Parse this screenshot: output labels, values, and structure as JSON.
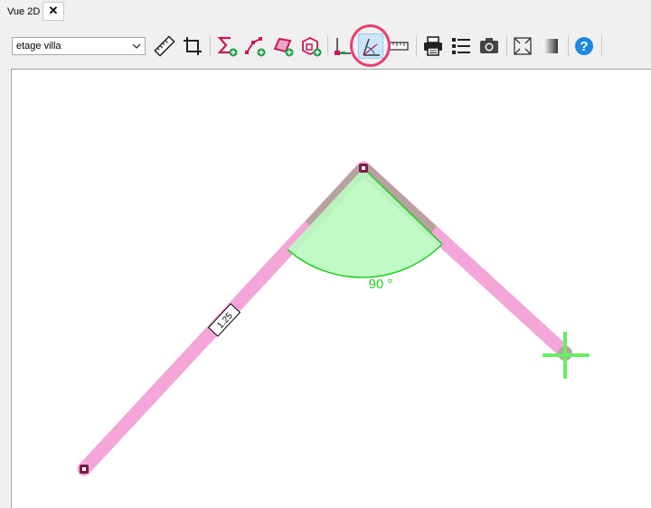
{
  "window": {
    "tab_title": "Vue 2D",
    "close_glyph": "✕"
  },
  "toolbar": {
    "floor_select": {
      "selected": "etage villa"
    },
    "buttons": [
      {
        "id": "measure",
        "icon": "ruler-icon"
      },
      {
        "id": "crop",
        "icon": "crop-icon"
      },
      {
        "id": "sum",
        "icon": "sum-add-icon"
      },
      {
        "id": "polyline",
        "icon": "polyline-add-icon"
      },
      {
        "id": "polygon",
        "icon": "polygon-add-icon"
      },
      {
        "id": "object",
        "icon": "object-add-icon"
      },
      {
        "id": "axis",
        "icon": "axis-icon"
      },
      {
        "id": "angle",
        "icon": "angle-icon",
        "active": true
      },
      {
        "id": "scale",
        "icon": "scale-ruler-icon"
      },
      {
        "id": "print",
        "icon": "printer-icon"
      },
      {
        "id": "list",
        "icon": "list-icon"
      },
      {
        "id": "snapshot",
        "icon": "camera-icon"
      },
      {
        "id": "fit",
        "icon": "fit-screen-icon"
      },
      {
        "id": "gradient",
        "icon": "gradient-icon"
      },
      {
        "id": "help",
        "icon": "help-icon"
      }
    ]
  },
  "drawing": {
    "segment_length_label": "1.25",
    "angle_label": "90 °",
    "colors": {
      "wall": "#f4a6d8",
      "angle_fill": "#b9fbc0",
      "angle_stroke": "#22cc22",
      "cursor": "#66ee66",
      "node": "#7a1c46",
      "highlight": "#e6426f"
    }
  }
}
